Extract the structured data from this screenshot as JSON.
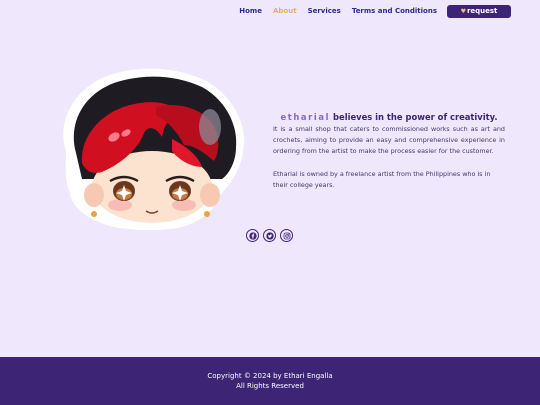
{
  "nav": {
    "items": [
      {
        "label": "Home",
        "active": false
      },
      {
        "label": "About",
        "active": true
      },
      {
        "label": "Services",
        "active": false
      },
      {
        "label": "Terms and Conditions",
        "active": false
      }
    ],
    "request_label": "request",
    "request_icon": "heart-icon"
  },
  "about": {
    "brand": "etharial",
    "headline_rest": " believes in the power of creativity.",
    "paragraph1": "It is a small shop that caters to commissioned works such as art and crochets, aiming to provide an easy and comprehensive experience in ordering from the artist to make the process easier for the customer.",
    "paragraph2": "Etharial is owned by a freelance artist from the Philippines who is in their college years."
  },
  "social": [
    "facebook-icon",
    "twitter-icon",
    "instagram-icon"
  ],
  "footer": {
    "copyright": "Copyright © 2024 by Ethari Engalla",
    "rights": "All Rights Reserved"
  },
  "colors": {
    "background": "#efe8fd",
    "primary": "#3e2475",
    "nav_text": "#2b2a8c",
    "active": "#e0b065",
    "brand_accent": "#8a62d8"
  }
}
